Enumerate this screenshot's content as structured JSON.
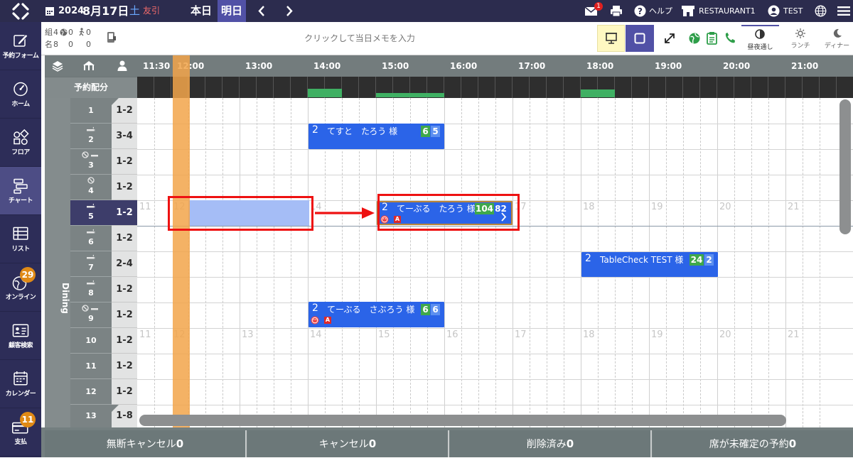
{
  "topbar": {
    "year": "2024",
    "date": "8月17日",
    "weekday": "土",
    "rokuyo": "友引",
    "today_btn": "本日",
    "tomorrow_btn": "明日",
    "mail_badge": "1",
    "help": "ヘルプ",
    "restaurant": "RESTAURANT1",
    "user": "TEST"
  },
  "sidebar": {
    "items": [
      {
        "label": "予約フォーム",
        "icon": "edit-icon"
      },
      {
        "label": "ホーム",
        "icon": "dashboard-icon"
      },
      {
        "label": "フロア",
        "icon": "floor-icon"
      },
      {
        "label": "チャート",
        "icon": "chart-icon"
      },
      {
        "label": "リスト",
        "icon": "list-icon"
      },
      {
        "label": "オンライン",
        "icon": "globe-icon",
        "badge": "29"
      },
      {
        "label": "顧客検索",
        "icon": "customer-card-icon"
      },
      {
        "label": "カレンダー",
        "icon": "calendar-icon"
      },
      {
        "label": "支払",
        "icon": "payment-card-icon",
        "badge": "11"
      }
    ]
  },
  "stats": {
    "groups_label": "組",
    "groups_count": "4",
    "online_groups": "0",
    "walkin_groups": "0",
    "people_label": "名",
    "people_count": "8",
    "online_people": "0",
    "walkin_people": "0"
  },
  "memo_placeholder": "クリックして当日メモを入力",
  "modes": {
    "dinner_through": "昼夜通し",
    "lunch": "ランチ",
    "dinner": "ディナー"
  },
  "grid": {
    "allocation_label": "予約配分",
    "section": "Dining",
    "times": [
      "11:30",
      "12:00",
      "13:00",
      "14:00",
      "15:00",
      "16:00",
      "17:00",
      "18:00",
      "19:00",
      "20:00",
      "21:00"
    ],
    "faint_hours": [
      "11",
      "12",
      "13",
      "14",
      "15",
      "16",
      "17",
      "18",
      "19",
      "20",
      "21"
    ],
    "rows": [
      {
        "num": "1",
        "cap": "1-2"
      },
      {
        "num": "2",
        "cap": "3-4"
      },
      {
        "num": "3",
        "cap": "1-2"
      },
      {
        "num": "4",
        "cap": "1-2"
      },
      {
        "num": "5",
        "cap": "1-2"
      },
      {
        "num": "6",
        "cap": "1-2"
      },
      {
        "num": "7",
        "cap": "2-4"
      },
      {
        "num": "8",
        "cap": "1-2"
      },
      {
        "num": "9",
        "cap": "1-2"
      },
      {
        "num": "10",
        "cap": "1-2"
      },
      {
        "num": "11",
        "cap": "1-2"
      },
      {
        "num": "12",
        "cap": "1-2"
      },
      {
        "num": "13",
        "cap": "1-8"
      }
    ],
    "reservations": [
      {
        "party": "2",
        "name": "てすと　たろう 様",
        "badge1": "6",
        "badge2": "5"
      },
      {
        "party": "2",
        "name": "てーぶる　たろう 様",
        "badge1": "104",
        "badge2": "82"
      },
      {
        "party": "2",
        "name": "TableCheck TEST 様",
        "badge1": "24",
        "badge2": "2"
      },
      {
        "party": "2",
        "name": "てーぶる　さぶろう 様",
        "badge1": "6",
        "badge2": "6"
      }
    ],
    "tag_a": "A"
  },
  "footer": {
    "noshow_label": "無断キャンセル",
    "noshow_count": "0",
    "cancel_label": "キャンセル",
    "cancel_count": "0",
    "deleted_label": "削除済み",
    "deleted_count": "0",
    "unassigned_label": "席が未確定の予約",
    "unassigned_count": "0"
  },
  "colors": {
    "accent": "#5151a6",
    "reservation": "#2b64e8",
    "highlight": "#ee1111",
    "now_marker": "#f2a54a",
    "badge_green": "#3fa84a"
  }
}
